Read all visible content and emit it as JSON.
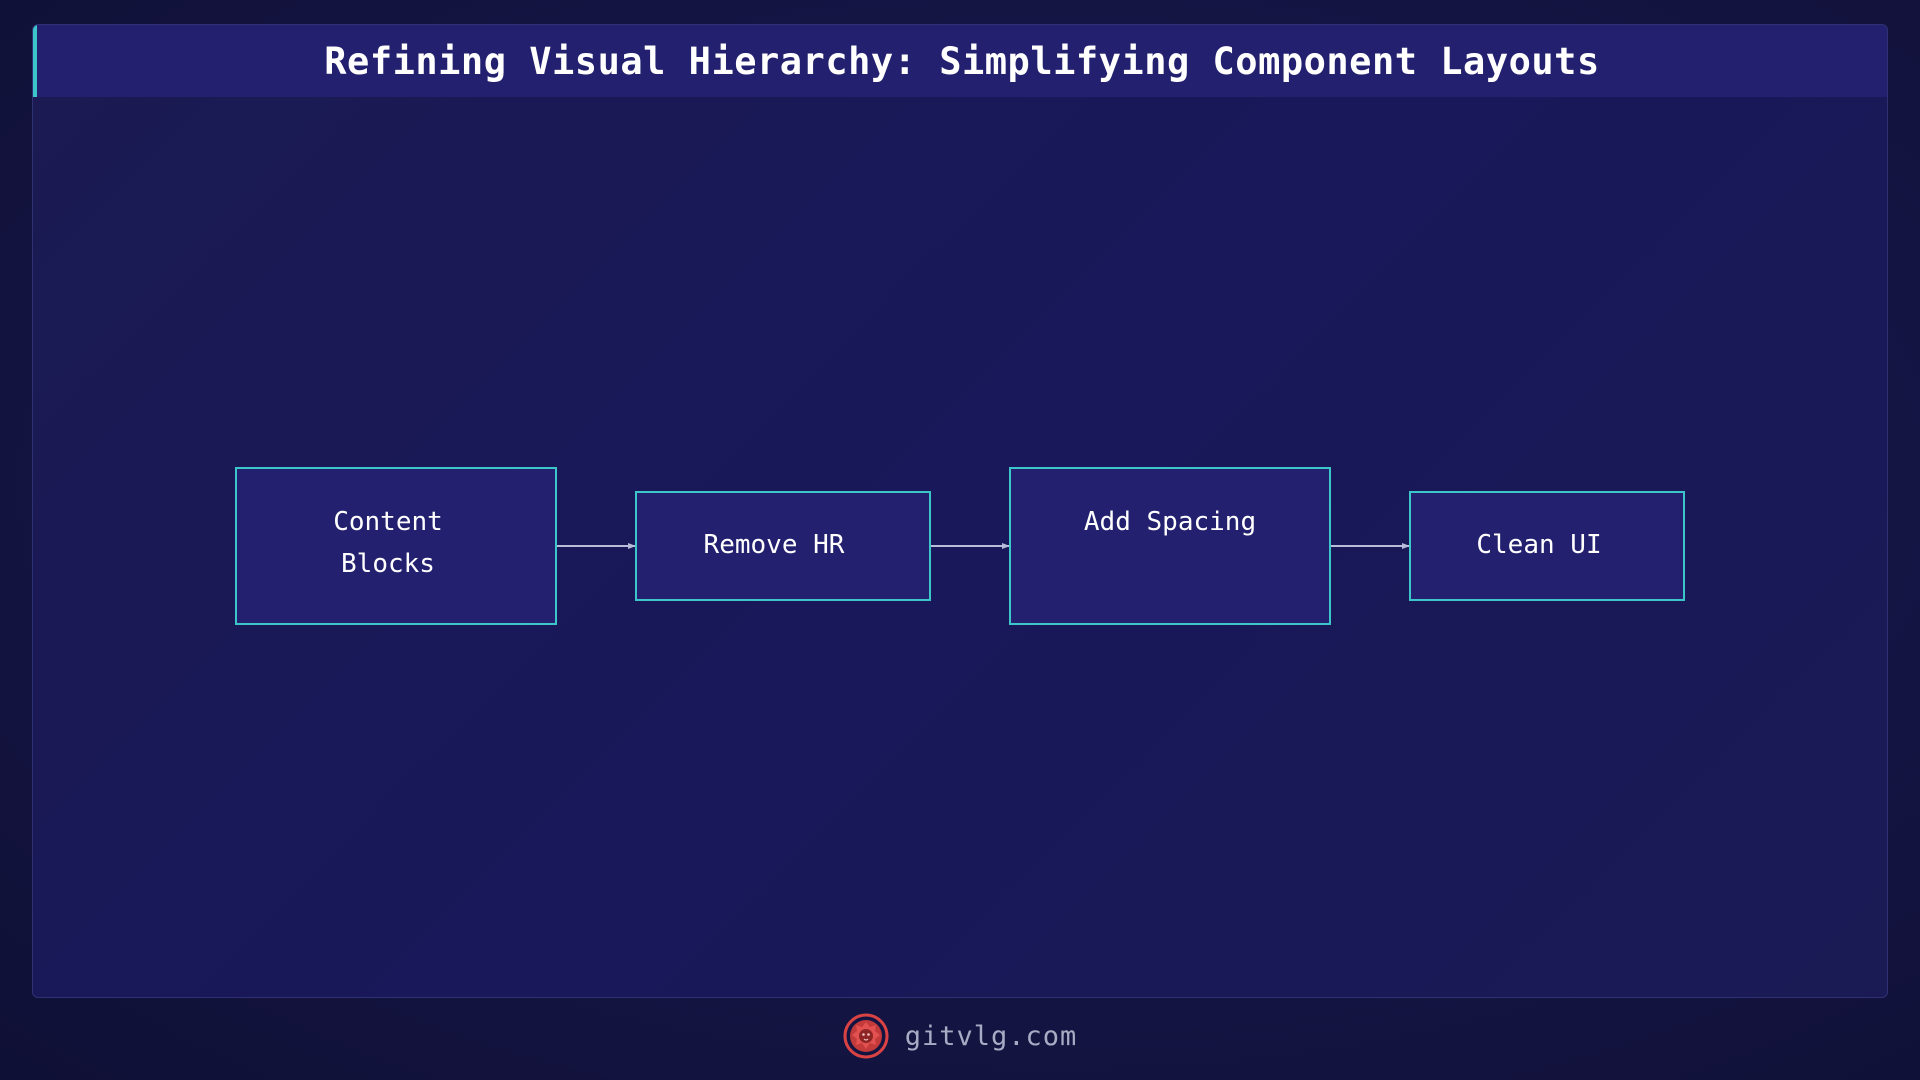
{
  "header": {
    "title": "Refining Visual Hierarchy: Simplifying Component Layouts"
  },
  "diagram": {
    "nodes": [
      {
        "id": "content-blocks",
        "label": "Content\n Blocks"
      },
      {
        "id": "remove-hr",
        "label": "Remove HR"
      },
      {
        "id": "add-spacing",
        "label": "Add Spacing"
      },
      {
        "id": "clean-ui",
        "label": "Clean UI"
      }
    ],
    "edges": [
      {
        "from": "content-blocks",
        "to": "remove-hr"
      },
      {
        "from": "remove-hr",
        "to": "add-spacing"
      },
      {
        "from": "add-spacing",
        "to": "clean-ui"
      }
    ]
  },
  "footer": {
    "logo_icon": "lion-head-icon",
    "text": "gitvlg.com"
  },
  "colors": {
    "background": "#151545",
    "header": "#23216f",
    "accent": "#3cc6c9",
    "node_fill": "#23216f",
    "node_border": "#3cc6c9",
    "edge": "#b8bcd8",
    "logo": "#d94343"
  }
}
